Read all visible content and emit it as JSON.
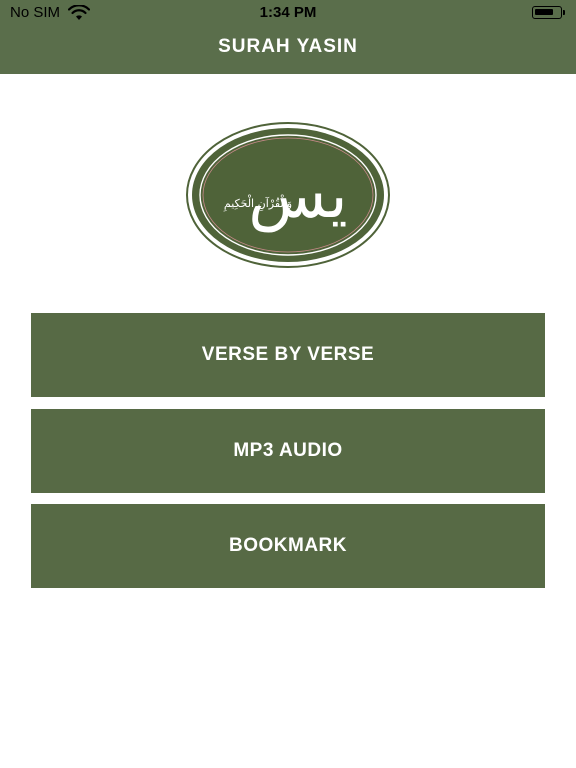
{
  "status_bar": {
    "carrier": "No SIM",
    "time": "1:34 PM"
  },
  "header": {
    "title": "SURAH YASIN"
  },
  "logo": {
    "calligraphy_main": "يس",
    "calligraphy_sub": "وَالْقُرْآنِ الْحَكِيمِ"
  },
  "menu": {
    "items": [
      {
        "label": "VERSE BY VERSE"
      },
      {
        "label": "MP3 AUDIO"
      },
      {
        "label": "BOOKMARK"
      }
    ]
  },
  "colors": {
    "primary": "#576a45",
    "header": "#5a6e4b",
    "background": "#ffffff",
    "text_on_primary": "#ffffff"
  },
  "icons": [
    "wifi-icon",
    "battery-icon"
  ]
}
